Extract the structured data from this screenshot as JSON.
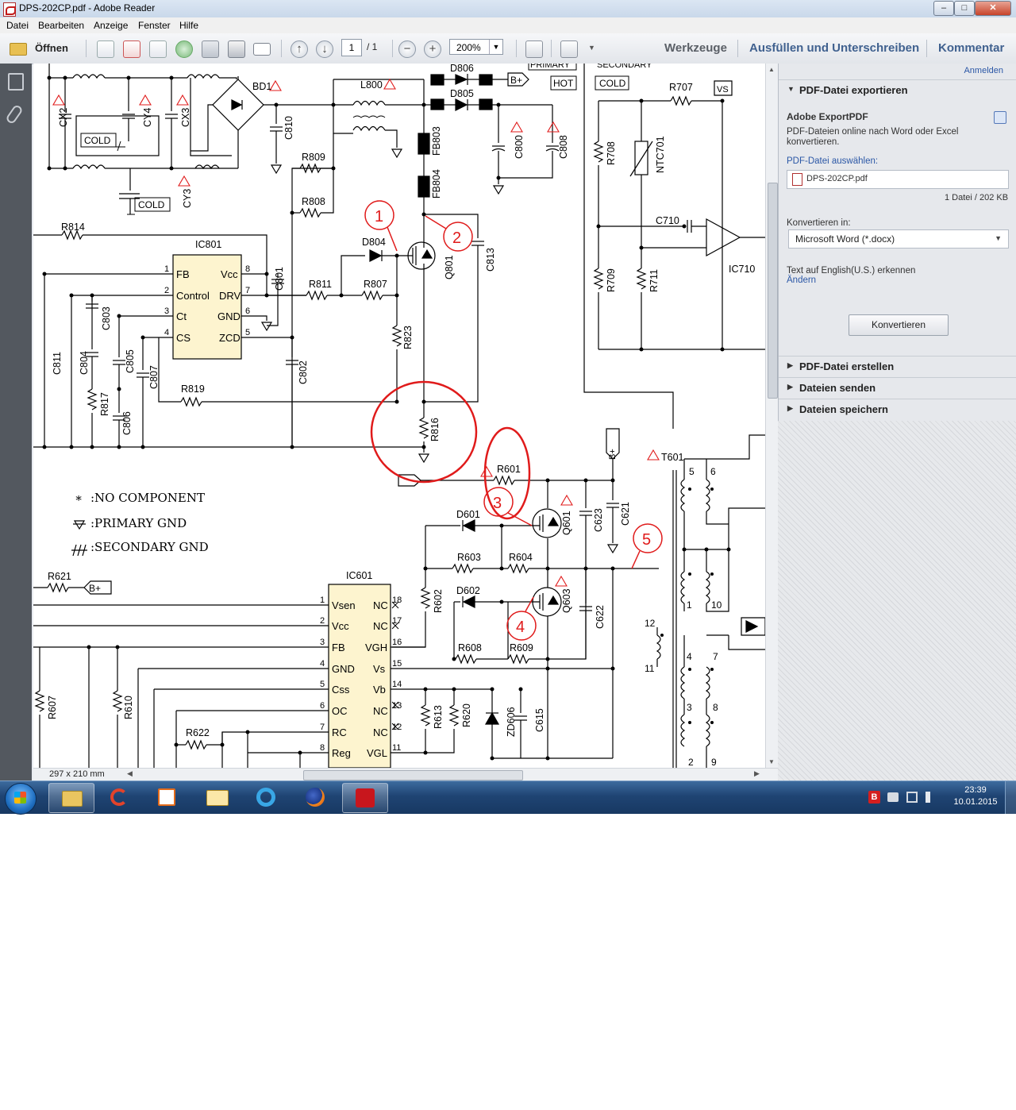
{
  "window": {
    "title": "DPS-202CP.pdf - Adobe Reader",
    "controls": {
      "minimize": "–",
      "maximize": "□",
      "close": "✕"
    }
  },
  "menu": [
    "Datei",
    "Bearbeiten",
    "Anzeige",
    "Fenster",
    "Hilfe"
  ],
  "toolbar": {
    "open_label": "Öffnen",
    "page_current": "1",
    "page_total": "/ 1",
    "zoom": "200%",
    "tabs": [
      "Werkzeuge",
      "Ausfüllen und Unterschreiben",
      "Kommentar"
    ]
  },
  "status": {
    "page_size": "297 x 210 mm"
  },
  "panel": {
    "signin": "Anmelden",
    "export": {
      "heading": "PDF-Datei exportieren",
      "service": "Adobe ExportPDF",
      "description": "PDF-Dateien online nach Word oder Excel konvertieren.",
      "select_label": "PDF-Datei auswählen:",
      "file_name": "DPS-202CP.pdf",
      "file_info": "1 Datei / 202 KB",
      "convert_label": "Konvertieren in:",
      "convert_value": "Microsoft Word (*.docx)",
      "ocr_text": "Text auf English(U.S.) erkennen",
      "ocr_change": "Ändern",
      "convert_button": "Konvertieren"
    },
    "sections": [
      "PDF-Datei erstellen",
      "Dateien senden",
      "Dateien speichern"
    ]
  },
  "schematic": {
    "labels": {
      "bd": "BD1",
      "l800": "L800",
      "d806": "D806",
      "d805": "D805",
      "bplus": "B+",
      "primary": "PRIMARY",
      "secondary": "SECONDARY",
      "hot": "HOT",
      "cold": "COLD",
      "r707": "R707",
      "vs": "VS",
      "cx2": "CX2",
      "cy4": "CY4",
      "cx3": "CX3",
      "cy3": "CY3",
      "c810": "C810",
      "r809": "R809",
      "r808": "R808",
      "fb803": "FB803",
      "fb804": "FB804",
      "c800": "C800",
      "c808": "C808",
      "r708": "R708",
      "ntc701": "NTC701",
      "c710": "C710",
      "ic710": "IC710",
      "r709": "R709",
      "r711": "R711",
      "r814": "R814",
      "ic801": "IC801",
      "d804": "D804",
      "q801": "Q801",
      "c813": "C813",
      "c801": "C801",
      "r811": "R811",
      "r807": "R807",
      "r823": "R823",
      "c811": "C811",
      "c804": "C804",
      "c803": "C803",
      "c805": "C805",
      "c807": "C807",
      "c806": "C806",
      "r817": "R817",
      "r819": "R819",
      "c802": "C802",
      "r816": "R816",
      "r601": "R601",
      "t601": "T601",
      "d601": "D601",
      "q601": "Q601",
      "c623": "C623",
      "c621": "C621",
      "r603": "R603",
      "r604": "R604",
      "d602": "D602",
      "q603": "Q603",
      "c622": "C622",
      "r602": "R602",
      "r608": "R608",
      "r609": "R609",
      "r621": "R621",
      "ic601": "IC601",
      "r607": "R607",
      "r610": "R610",
      "r622": "R622",
      "r613": "R613",
      "r620": "R620",
      "zd606": "ZD606",
      "c615": "C615"
    },
    "ic801_pins_left": [
      "FB",
      "Control",
      "Ct",
      "CS"
    ],
    "ic801_pins_right": [
      "Vcc",
      "DRV",
      "GND",
      "ZCD"
    ],
    "ic801_num_left": [
      "1",
      "2",
      "3",
      "4"
    ],
    "ic801_num_right": [
      "8",
      "7",
      "6",
      "5"
    ],
    "ic601_pins_left": [
      "Vsen",
      "Vcc",
      "FB",
      "GND",
      "Css",
      "OC",
      "RC",
      "Reg"
    ],
    "ic601_pins_right": [
      "NC",
      "NC",
      "VGH",
      "Vs",
      "Vb",
      "NC",
      "NC",
      "VGL"
    ],
    "ic601_num_left": [
      "1",
      "2",
      "3",
      "4",
      "5",
      "6",
      "7",
      "8"
    ],
    "ic601_num_right": [
      "18",
      "17",
      "16",
      "15",
      "14",
      "13",
      "12",
      "11"
    ],
    "legend": {
      "no_component": ":NO COMPONENT",
      "primary_gnd": ":PRIMARY GND",
      "secondary_gnd": ":SECONDARY GND"
    },
    "markers": [
      "1",
      "2",
      "3",
      "4",
      "5"
    ],
    "transformer_pins": [
      "5",
      "6",
      "1",
      "10",
      "12",
      "11",
      "4",
      "7",
      "3",
      "8",
      "2",
      "9"
    ]
  },
  "taskbar": {
    "clock_time": "23:39",
    "clock_date": "10.01.2015",
    "tray_badge": "B"
  },
  "colors": {
    "annotation_red": "#e01b1b",
    "link_blue": "#2b57a6",
    "panel_bg": "#e6e8ec",
    "taskbar": "#1f4473"
  }
}
